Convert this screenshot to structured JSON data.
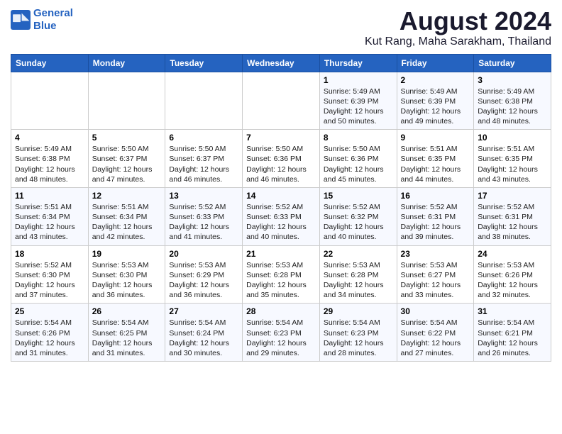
{
  "logo": {
    "line1": "General",
    "line2": "Blue"
  },
  "title": "August 2024",
  "subtitle": "Kut Rang, Maha Sarakham, Thailand",
  "days_of_week": [
    "Sunday",
    "Monday",
    "Tuesday",
    "Wednesday",
    "Thursday",
    "Friday",
    "Saturday"
  ],
  "weeks": [
    [
      {
        "day": "",
        "content": ""
      },
      {
        "day": "",
        "content": ""
      },
      {
        "day": "",
        "content": ""
      },
      {
        "day": "",
        "content": ""
      },
      {
        "day": "1",
        "content": "Sunrise: 5:49 AM\nSunset: 6:39 PM\nDaylight: 12 hours\nand 50 minutes."
      },
      {
        "day": "2",
        "content": "Sunrise: 5:49 AM\nSunset: 6:39 PM\nDaylight: 12 hours\nand 49 minutes."
      },
      {
        "day": "3",
        "content": "Sunrise: 5:49 AM\nSunset: 6:38 PM\nDaylight: 12 hours\nand 48 minutes."
      }
    ],
    [
      {
        "day": "4",
        "content": "Sunrise: 5:49 AM\nSunset: 6:38 PM\nDaylight: 12 hours\nand 48 minutes."
      },
      {
        "day": "5",
        "content": "Sunrise: 5:50 AM\nSunset: 6:37 PM\nDaylight: 12 hours\nand 47 minutes."
      },
      {
        "day": "6",
        "content": "Sunrise: 5:50 AM\nSunset: 6:37 PM\nDaylight: 12 hours\nand 46 minutes."
      },
      {
        "day": "7",
        "content": "Sunrise: 5:50 AM\nSunset: 6:36 PM\nDaylight: 12 hours\nand 46 minutes."
      },
      {
        "day": "8",
        "content": "Sunrise: 5:50 AM\nSunset: 6:36 PM\nDaylight: 12 hours\nand 45 minutes."
      },
      {
        "day": "9",
        "content": "Sunrise: 5:51 AM\nSunset: 6:35 PM\nDaylight: 12 hours\nand 44 minutes."
      },
      {
        "day": "10",
        "content": "Sunrise: 5:51 AM\nSunset: 6:35 PM\nDaylight: 12 hours\nand 43 minutes."
      }
    ],
    [
      {
        "day": "11",
        "content": "Sunrise: 5:51 AM\nSunset: 6:34 PM\nDaylight: 12 hours\nand 43 minutes."
      },
      {
        "day": "12",
        "content": "Sunrise: 5:51 AM\nSunset: 6:34 PM\nDaylight: 12 hours\nand 42 minutes."
      },
      {
        "day": "13",
        "content": "Sunrise: 5:52 AM\nSunset: 6:33 PM\nDaylight: 12 hours\nand 41 minutes."
      },
      {
        "day": "14",
        "content": "Sunrise: 5:52 AM\nSunset: 6:33 PM\nDaylight: 12 hours\nand 40 minutes."
      },
      {
        "day": "15",
        "content": "Sunrise: 5:52 AM\nSunset: 6:32 PM\nDaylight: 12 hours\nand 40 minutes."
      },
      {
        "day": "16",
        "content": "Sunrise: 5:52 AM\nSunset: 6:31 PM\nDaylight: 12 hours\nand 39 minutes."
      },
      {
        "day": "17",
        "content": "Sunrise: 5:52 AM\nSunset: 6:31 PM\nDaylight: 12 hours\nand 38 minutes."
      }
    ],
    [
      {
        "day": "18",
        "content": "Sunrise: 5:52 AM\nSunset: 6:30 PM\nDaylight: 12 hours\nand 37 minutes."
      },
      {
        "day": "19",
        "content": "Sunrise: 5:53 AM\nSunset: 6:30 PM\nDaylight: 12 hours\nand 36 minutes."
      },
      {
        "day": "20",
        "content": "Sunrise: 5:53 AM\nSunset: 6:29 PM\nDaylight: 12 hours\nand 36 minutes."
      },
      {
        "day": "21",
        "content": "Sunrise: 5:53 AM\nSunset: 6:28 PM\nDaylight: 12 hours\nand 35 minutes."
      },
      {
        "day": "22",
        "content": "Sunrise: 5:53 AM\nSunset: 6:28 PM\nDaylight: 12 hours\nand 34 minutes."
      },
      {
        "day": "23",
        "content": "Sunrise: 5:53 AM\nSunset: 6:27 PM\nDaylight: 12 hours\nand 33 minutes."
      },
      {
        "day": "24",
        "content": "Sunrise: 5:53 AM\nSunset: 6:26 PM\nDaylight: 12 hours\nand 32 minutes."
      }
    ],
    [
      {
        "day": "25",
        "content": "Sunrise: 5:54 AM\nSunset: 6:26 PM\nDaylight: 12 hours\nand 31 minutes."
      },
      {
        "day": "26",
        "content": "Sunrise: 5:54 AM\nSunset: 6:25 PM\nDaylight: 12 hours\nand 31 minutes."
      },
      {
        "day": "27",
        "content": "Sunrise: 5:54 AM\nSunset: 6:24 PM\nDaylight: 12 hours\nand 30 minutes."
      },
      {
        "day": "28",
        "content": "Sunrise: 5:54 AM\nSunset: 6:23 PM\nDaylight: 12 hours\nand 29 minutes."
      },
      {
        "day": "29",
        "content": "Sunrise: 5:54 AM\nSunset: 6:23 PM\nDaylight: 12 hours\nand 28 minutes."
      },
      {
        "day": "30",
        "content": "Sunrise: 5:54 AM\nSunset: 6:22 PM\nDaylight: 12 hours\nand 27 minutes."
      },
      {
        "day": "31",
        "content": "Sunrise: 5:54 AM\nSunset: 6:21 PM\nDaylight: 12 hours\nand 26 minutes."
      }
    ]
  ]
}
